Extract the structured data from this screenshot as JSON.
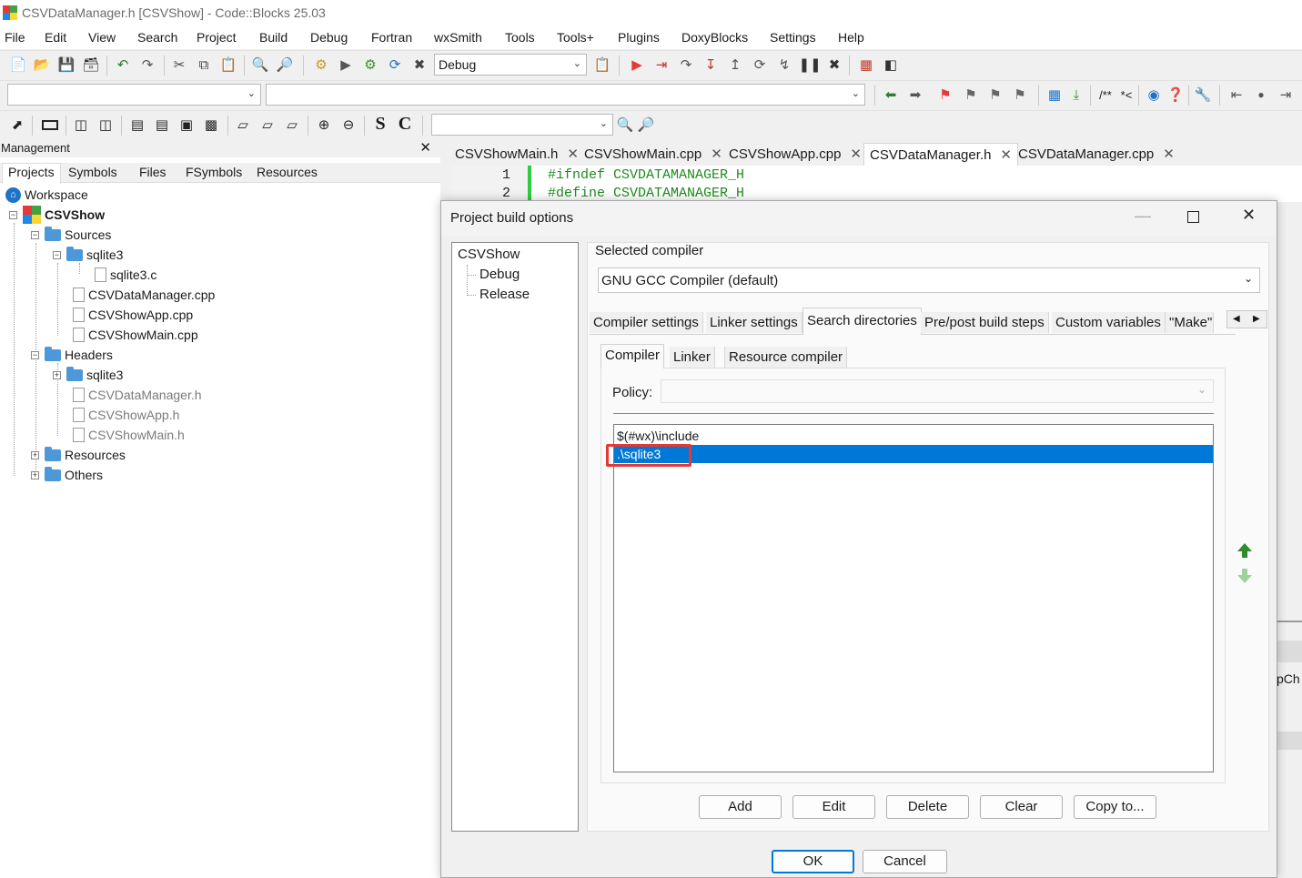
{
  "window": {
    "title": "CSVDataManager.h [CSVShow] - Code::Blocks 25.03"
  },
  "menu": [
    "File",
    "Edit",
    "View",
    "Search",
    "Project",
    "Build",
    "Debug",
    "Fortran",
    "wxSmith",
    "Tools",
    "Tools+",
    "Plugins",
    "DoxyBlocks",
    "Settings",
    "Help"
  ],
  "toolbar": {
    "build_target": "Debug",
    "doxy_comment_labels": [
      "/**",
      "*<"
    ],
    "wx_letters": [
      "S",
      "C"
    ]
  },
  "management": {
    "title": "Management",
    "close": "✕",
    "tabs": [
      "Projects",
      "Symbols",
      "Files",
      "FSymbols",
      "Resources"
    ],
    "tree": {
      "workspace": "Workspace",
      "project": "CSVShow",
      "sources": "Sources",
      "sources_sqlite3": "sqlite3",
      "sqlite3_c": "sqlite3.c",
      "source_files": [
        "CSVDataManager.cpp",
        "CSVShowApp.cpp",
        "CSVShowMain.cpp"
      ],
      "headers": "Headers",
      "headers_sqlite3": "sqlite3",
      "header_files": [
        "CSVDataManager.h",
        "CSVShowApp.h",
        "CSVShowMain.h"
      ],
      "resources": "Resources",
      "others": "Others"
    }
  },
  "editor": {
    "tabs": [
      {
        "label": "CSVShowMain.h"
      },
      {
        "label": "CSVShowMain.cpp"
      },
      {
        "label": "CSVShowApp.cpp"
      },
      {
        "label": "CSVDataManager.h"
      },
      {
        "label": "CSVDataManager.cpp"
      }
    ],
    "close_glyph": "✕",
    "lines": [
      {
        "no": "1",
        "code": "#ifndef CSVDATAMANAGER_H"
      },
      {
        "no": "2",
        "code": "#define CSVDATAMANAGER_H"
      }
    ],
    "right_clip_text": "pCh"
  },
  "dialog": {
    "title": "Project build options",
    "targets": [
      "CSVShow",
      "Debug",
      "Release"
    ],
    "selected_compiler_label": "Selected compiler",
    "selected_compiler": "GNU GCC Compiler (default)",
    "tabs": [
      "Compiler settings",
      "Linker settings",
      "Search directories",
      "Pre/post build steps",
      "Custom variables",
      "\"Make\" c"
    ],
    "subtabs": [
      "Compiler",
      "Linker",
      "Resource compiler"
    ],
    "policy_label": "Policy:",
    "policy_value": "",
    "directories": [
      "$(#wx)\\include",
      ".\\sqlite3"
    ],
    "selected_directory_index": 1,
    "buttons": {
      "add": "Add",
      "edit": "Edit",
      "delete": "Delete",
      "clear": "Clear",
      "copy_to": "Copy to..."
    },
    "ok": "OK",
    "cancel": "Cancel"
  },
  "colors": {
    "selection": "#0078d7",
    "highlight_box": "#e53935",
    "code_green": "#1e8c1e",
    "changebar": "#2ecc40"
  }
}
